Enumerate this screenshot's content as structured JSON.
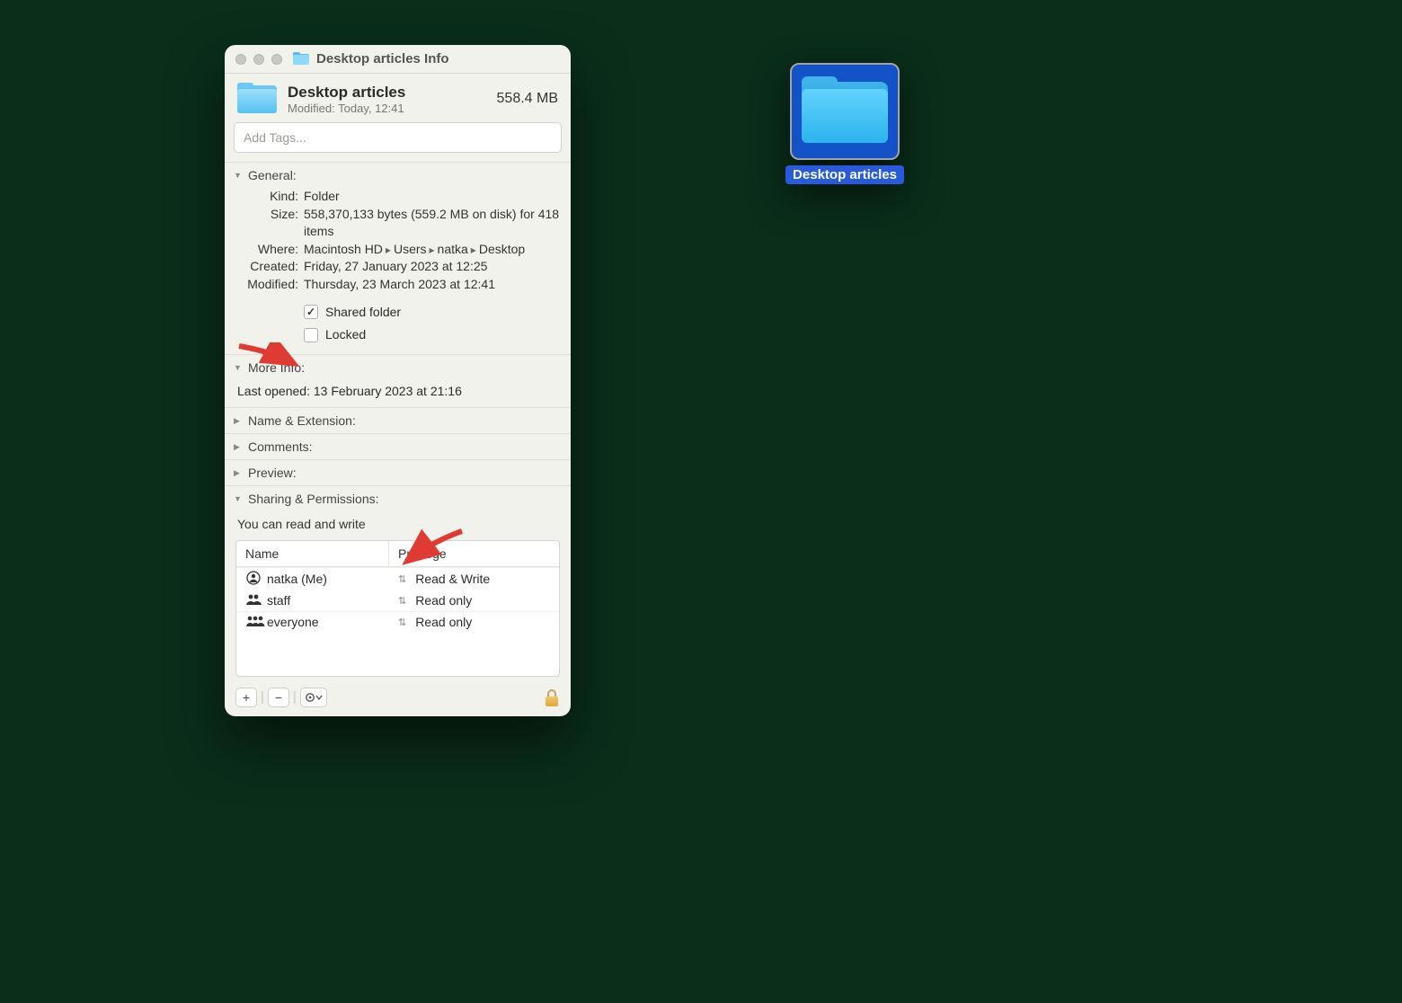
{
  "window": {
    "title": "Desktop articles Info"
  },
  "header": {
    "name": "Desktop articles",
    "modified_label": "Modified:",
    "modified_value": "Today, 12:41",
    "size": "558.4 MB"
  },
  "tags": {
    "placeholder": "Add Tags..."
  },
  "sections": {
    "general_title": "General:",
    "more_info_title": "More Info:",
    "name_ext_title": "Name & Extension:",
    "comments_title": "Comments:",
    "preview_title": "Preview:",
    "sharing_title": "Sharing & Permissions:"
  },
  "general": {
    "kind_label": "Kind:",
    "kind_value": "Folder",
    "size_label": "Size:",
    "size_value": "558,370,133 bytes (559.2 MB on disk) for 418 items",
    "where_label": "Where:",
    "where_parts": [
      "Macintosh HD",
      "Users",
      "natka",
      "Desktop"
    ],
    "created_label": "Created:",
    "created_value": "Friday, 27 January 2023 at 12:25",
    "modified_label": "Modified:",
    "modified_value": "Thursday, 23 March 2023 at 12:41",
    "shared_folder_label": "Shared folder",
    "shared_folder_checked": true,
    "locked_label": "Locked",
    "locked_checked": false
  },
  "more_info": {
    "last_opened_label": "Last opened:",
    "last_opened_value": "13 February 2023 at 21:16"
  },
  "sharing": {
    "note": "You can read and write",
    "columns": {
      "name": "Name",
      "privilege": "Privilege"
    },
    "rows": [
      {
        "icon": "user",
        "name": "natka (Me)",
        "privilege": "Read & Write"
      },
      {
        "icon": "group2",
        "name": "staff",
        "privilege": "Read only"
      },
      {
        "icon": "group3",
        "name": "everyone",
        "privilege": "Read only"
      }
    ]
  },
  "toolbar": {
    "add_label": "+",
    "remove_label": "−",
    "action_label": "⊙∨"
  },
  "desktop_item": {
    "label": "Desktop articles"
  }
}
